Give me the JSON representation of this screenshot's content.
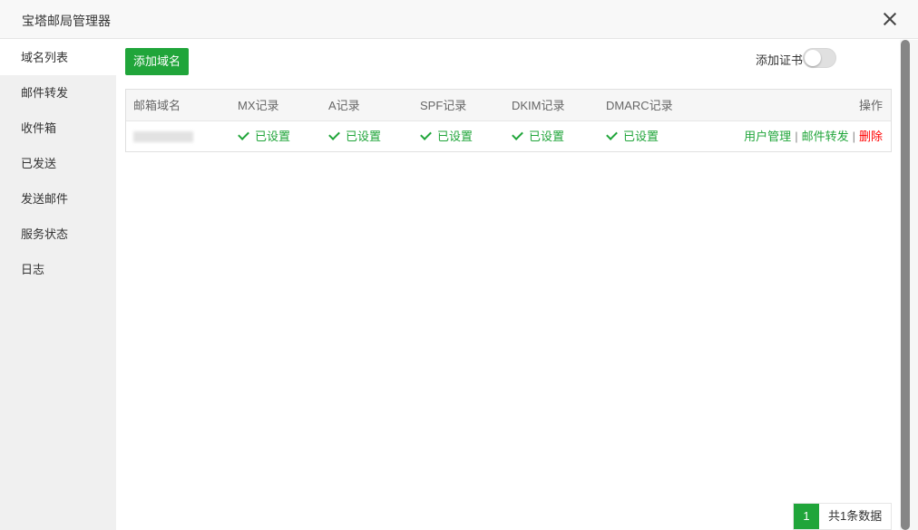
{
  "modal": {
    "title": "宝塔邮局管理器"
  },
  "sidebar": {
    "items": [
      {
        "label": "域名列表"
      },
      {
        "label": "邮件转发"
      },
      {
        "label": "收件箱"
      },
      {
        "label": "已发送"
      },
      {
        "label": "发送邮件"
      },
      {
        "label": "服务状态"
      },
      {
        "label": "日志"
      }
    ]
  },
  "toolbar": {
    "add_domain_label": "添加域名",
    "add_cert_label": "添加证书",
    "cert_enabled": false
  },
  "table": {
    "headers": {
      "domain": "邮箱域名",
      "mx": "MX记录",
      "a": "A记录",
      "spf": "SPF记录",
      "dkim": "DKIM记录",
      "dmarc": "DMARC记录",
      "actions": "操作"
    },
    "rows": [
      {
        "mx": "已设置",
        "a": "已设置",
        "spf": "已设置",
        "dkim": "已设置",
        "dmarc": "已设置",
        "action_users": "用户管理",
        "action_forward": "邮件转发",
        "action_delete": "删除",
        "sep": "|"
      }
    ]
  },
  "pagination": {
    "current_page": "1",
    "total_text": "共1条数据"
  },
  "colors": {
    "accent": "#20a53a",
    "danger": "#ff0000"
  }
}
